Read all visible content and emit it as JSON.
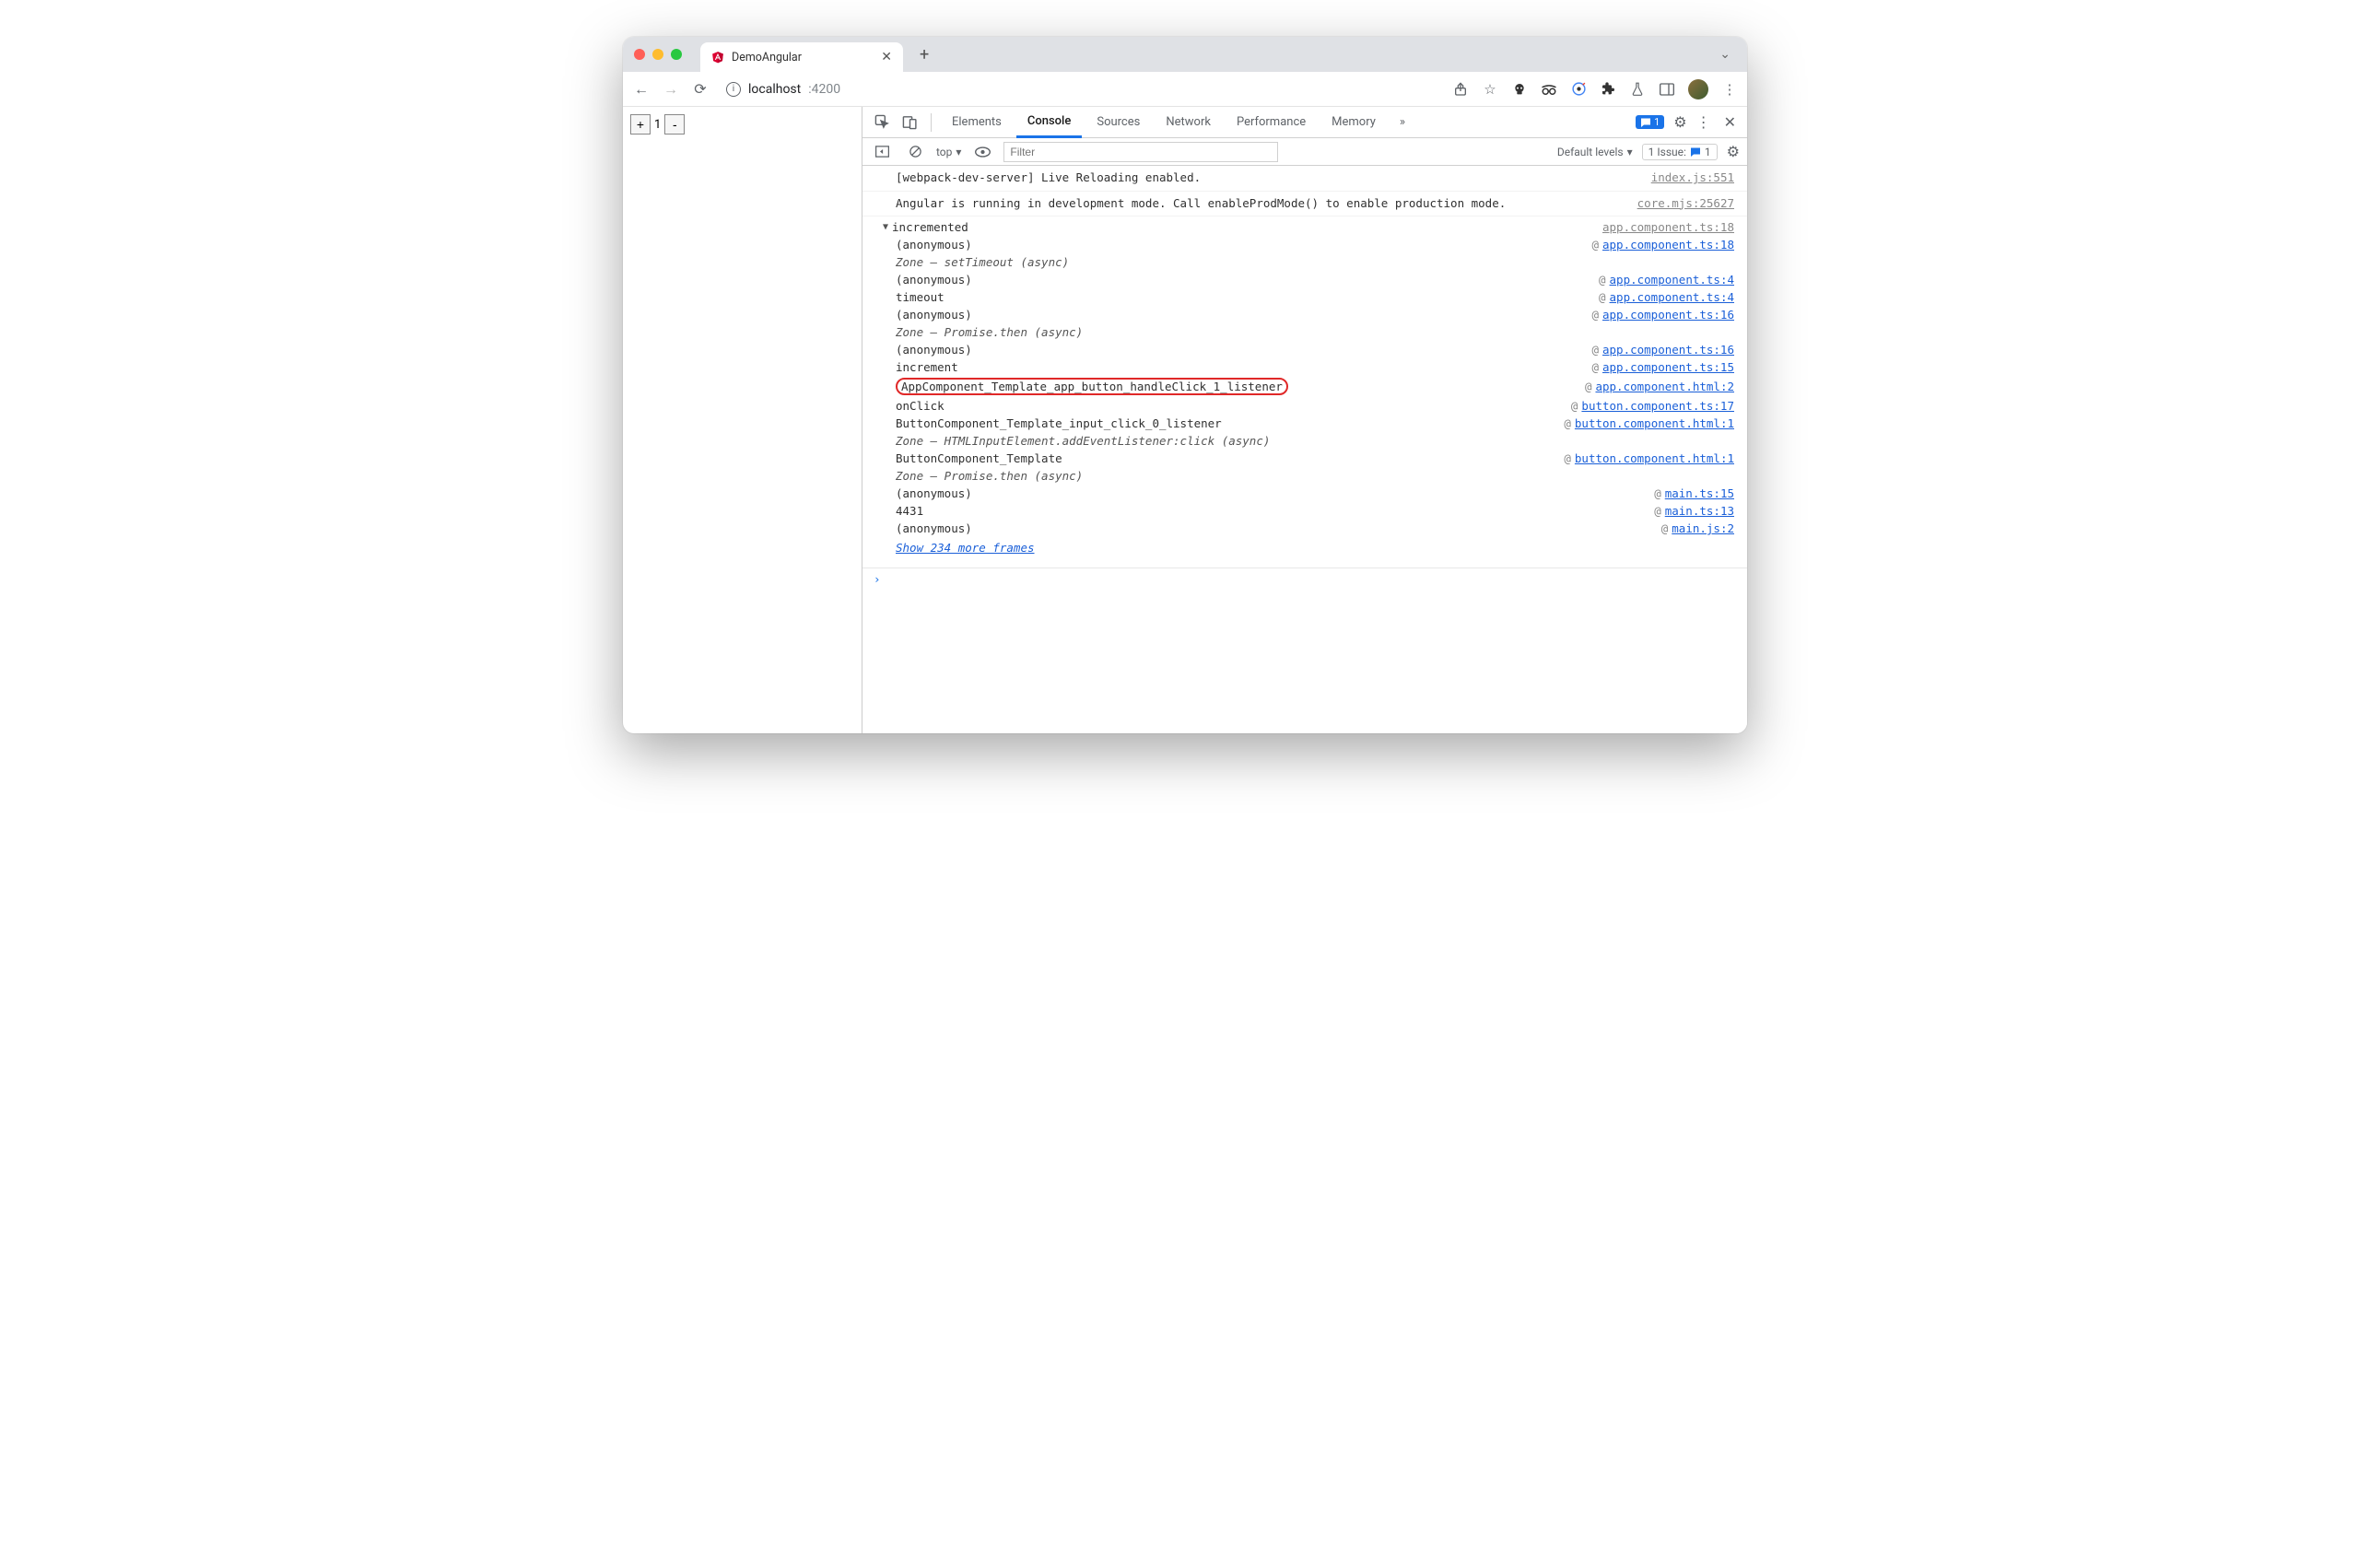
{
  "browser": {
    "tab_title": "DemoAngular",
    "url_host": "localhost",
    "url_port": ":4200"
  },
  "page": {
    "counter_value": "1",
    "inc": "+",
    "dec": "-"
  },
  "devtools": {
    "tabs": {
      "elements": "Elements",
      "console": "Console",
      "sources": "Sources",
      "network": "Network",
      "performance": "Performance",
      "memory": "Memory"
    },
    "badge_count": "1",
    "context": "top",
    "filter_placeholder": "Filter",
    "levels": "Default levels",
    "issues_label": "1 Issue:",
    "issues_count": "1"
  },
  "console": {
    "log1": {
      "msg": "[webpack-dev-server] Live Reloading enabled.",
      "src": "index.js:551"
    },
    "log2": {
      "msg": "Angular is running in development mode. Call enableProdMode() to enable production mode.",
      "src": "core.mjs:25627"
    },
    "group_label": "incremented",
    "group_src": "app.component.ts:18",
    "stack": [
      {
        "fn": "(anonymous)",
        "src": "app.component.ts:18"
      },
      {
        "fn": "Zone — setTimeout (async)",
        "italic": true
      },
      {
        "fn": "(anonymous)",
        "src": "app.component.ts:4"
      },
      {
        "fn": "timeout",
        "src": "app.component.ts:4"
      },
      {
        "fn": "(anonymous)",
        "src": "app.component.ts:16"
      },
      {
        "fn": "Zone — Promise.then (async)",
        "italic": true
      },
      {
        "fn": "(anonymous)",
        "src": "app.component.ts:16"
      },
      {
        "fn": "increment",
        "src": "app.component.ts:15"
      },
      {
        "fn": "AppComponent_Template_app_button_handleClick_1_listener",
        "src": "app.component.html:2",
        "hl": true
      },
      {
        "fn": "onClick",
        "src": "button.component.ts:17"
      },
      {
        "fn": "ButtonComponent_Template_input_click_0_listener",
        "src": "button.component.html:1"
      },
      {
        "fn": "Zone — HTMLInputElement.addEventListener:click (async)",
        "italic": true
      },
      {
        "fn": "ButtonComponent_Template",
        "src": "button.component.html:1"
      },
      {
        "fn": "Zone — Promise.then (async)",
        "italic": true
      },
      {
        "fn": "(anonymous)",
        "src": "main.ts:15"
      },
      {
        "fn": "4431",
        "src": "main.ts:13"
      },
      {
        "fn": "(anonymous)",
        "src": "main.js:2"
      }
    ],
    "show_more": "Show 234 more frames"
  }
}
